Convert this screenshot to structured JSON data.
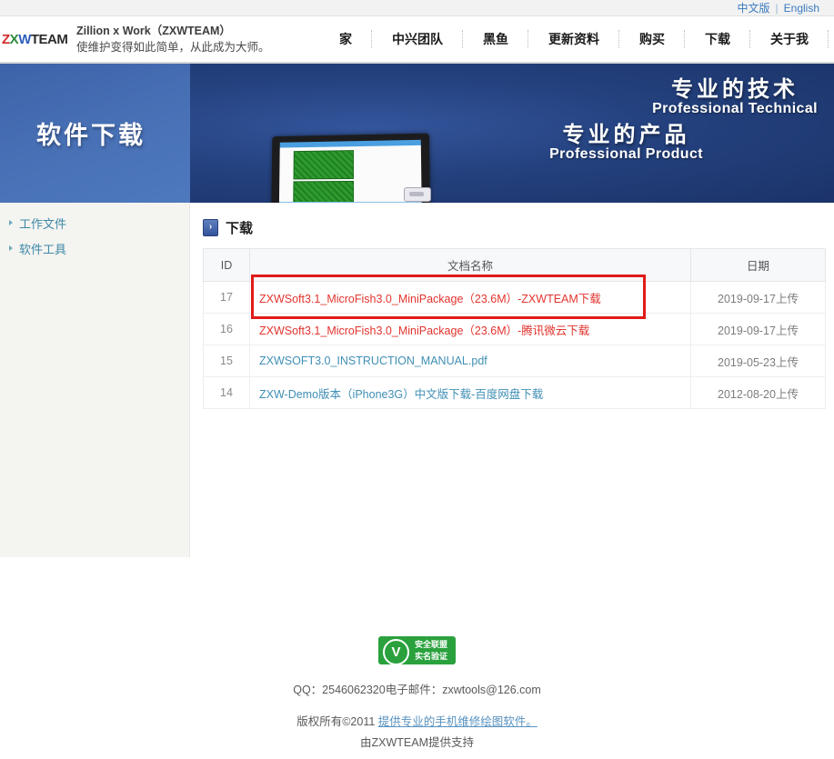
{
  "langbar": {
    "chinese": "中文版",
    "separator": "|",
    "english": "English"
  },
  "header": {
    "logo": {
      "part1": "Z",
      "part2": "X",
      "part3": "W",
      "part4": "TEAM"
    },
    "brand_line1": "Zillion x Work（ZXWTEAM）",
    "brand_line2": "使维护变得如此简单，从此成为大师。",
    "nav": [
      {
        "label": "家"
      },
      {
        "label": "中兴团队"
      },
      {
        "label": "黑鱼"
      },
      {
        "label": "更新资料"
      },
      {
        "label": "购买"
      },
      {
        "label": "下载"
      },
      {
        "label": "关于我"
      }
    ]
  },
  "banner": {
    "title": "软件下载",
    "slogan1_cn": "专业的技术",
    "slogan1_en": "Professional Technical",
    "slogan2_cn": "专业的产品",
    "slogan2_en": "Professional Product"
  },
  "sidebar": {
    "items": [
      {
        "label": "工作文件"
      },
      {
        "label": "软件工具"
      }
    ]
  },
  "main": {
    "breadcrumb_icon": "›",
    "breadcrumb": "下载",
    "table": {
      "columns": [
        "ID",
        "文档名称",
        "日期"
      ],
      "rows": [
        {
          "id": "17",
          "name": "ZXWSoft3.1_MicroFish3.0_MiniPackage（23.6M）-ZXWTEAM下载",
          "date": "2019-09-17上传",
          "color": "red",
          "highlighted": true
        },
        {
          "id": "16",
          "name": "ZXWSoft3.1_MicroFish3.0_MiniPackage（23.6M）-腾讯微云下载",
          "date": "2019-09-17上传",
          "color": "red",
          "highlighted": false
        },
        {
          "id": "15",
          "name": "ZXWSOFT3.0_INSTRUCTION_MANUAL.pdf",
          "date": "2019-05-23上传",
          "color": "blue",
          "highlighted": false
        },
        {
          "id": "14",
          "name": "ZXW-Demo版本（iPhone3G）中文版下载-百度网盘下载",
          "date": "2012-08-20上传",
          "color": "blue",
          "highlighted": false
        }
      ]
    }
  },
  "footer": {
    "badge_mark": "V",
    "badge_line1": "安全联盟",
    "badge_line2": "实名验证",
    "contact": "QQ：2546062320电子邮件：zxwtools@126.com",
    "copyright_prefix": "版权所有©2011 ",
    "copyright_link": "提供专业的手机维修绘图软件。",
    "powered_by": "由ZXWTEAM提供支持"
  },
  "colors": {
    "link_red": "#e2342e",
    "link_blue": "#3f8fb5",
    "highlight_border": "#e01b17",
    "banner_blue": "#2b4f92",
    "badge_green": "#2aa13d"
  }
}
